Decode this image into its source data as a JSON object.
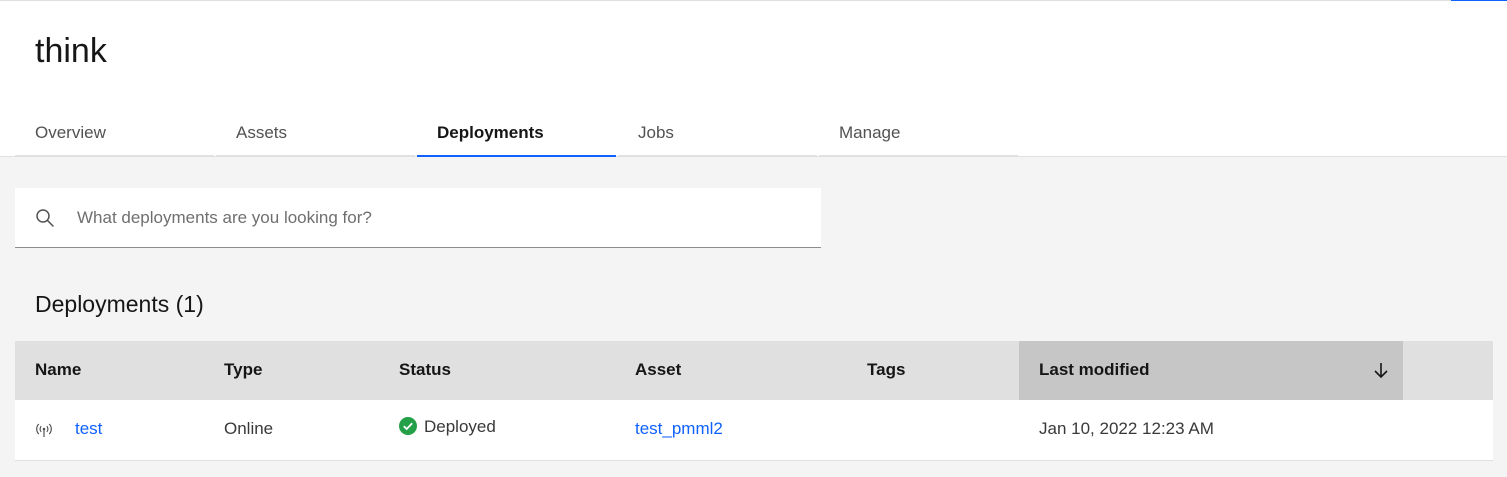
{
  "project": {
    "title": "think"
  },
  "tabs": [
    {
      "label": "Overview",
      "active": false
    },
    {
      "label": "Assets",
      "active": false
    },
    {
      "label": "Deployments",
      "active": true
    },
    {
      "label": "Jobs",
      "active": false
    },
    {
      "label": "Manage",
      "active": false
    }
  ],
  "search": {
    "placeholder": "What deployments are you looking for?",
    "value": "",
    "icon": "search-icon"
  },
  "section": {
    "title": "Deployments (1)"
  },
  "table": {
    "columns": [
      "Name",
      "Type",
      "Status",
      "Asset",
      "Tags",
      "Last modified"
    ],
    "sorted_column": "Last modified",
    "sort_direction": "descending",
    "rows": [
      {
        "name": "test",
        "type": "Online",
        "status": "Deployed",
        "asset": "test_pmml2",
        "tags": "",
        "last_modified": "Jan 10, 2022 12:23 AM",
        "icon": "deployment-antenna-icon",
        "status_icon": "checkmark-filled-icon"
      }
    ]
  },
  "colors": {
    "accent": "#0f62fe",
    "success": "#24a148",
    "background": "#f4f4f4",
    "header_row": "#e0e0e0",
    "sorted_header": "#c6c6c6"
  }
}
